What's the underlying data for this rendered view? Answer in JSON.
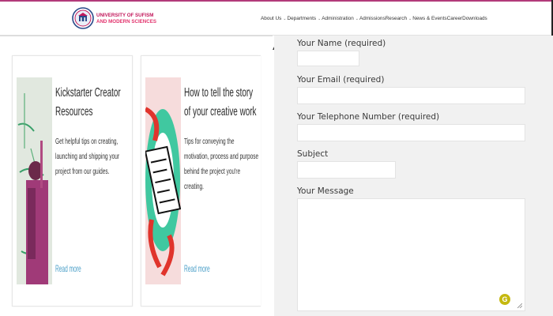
{
  "brand": {
    "line1": "UNIVERSITY OF SUFISM",
    "line2": "AND MODERN SCIENCES",
    "colors": {
      "primary": "#c2185b",
      "topline": "#b23a7a"
    }
  },
  "nav": {
    "items": [
      {
        "label": "About Us",
        "has_dropdown": true
      },
      {
        "label": "Departments",
        "has_dropdown": true
      },
      {
        "label": "Administration",
        "has_dropdown": true
      },
      {
        "label": "Admissions",
        "has_dropdown": false
      },
      {
        "label": "Research",
        "has_dropdown": true
      },
      {
        "label": "News & Events",
        "has_dropdown": false
      },
      {
        "label": "Career",
        "has_dropdown": false
      },
      {
        "label": "Downloads",
        "has_dropdown": false
      }
    ]
  },
  "cards": [
    {
      "title": "Kickstarter Creator Resources",
      "description": "Get helpful tips on creating, launching and shipping your project from our guides.",
      "link": "Read more"
    },
    {
      "title": "How to tell the story of your creative work",
      "description": "Tips for conveying the motivation, process and purpose behind the project you're creating.",
      "link": "Read more"
    }
  ],
  "form": {
    "name_label": "Your Name (required)",
    "email_label": "Your Email (required)",
    "phone_label": "Your Telephone Number (required)",
    "subject_label": "Subject",
    "message_label": "Your Message",
    "name_value": "",
    "email_value": "",
    "phone_value": "",
    "subject_value": "",
    "message_value": ""
  },
  "widget": {
    "icon": "grammarly-icon",
    "glyph": "G",
    "color": "#c5b80f"
  }
}
